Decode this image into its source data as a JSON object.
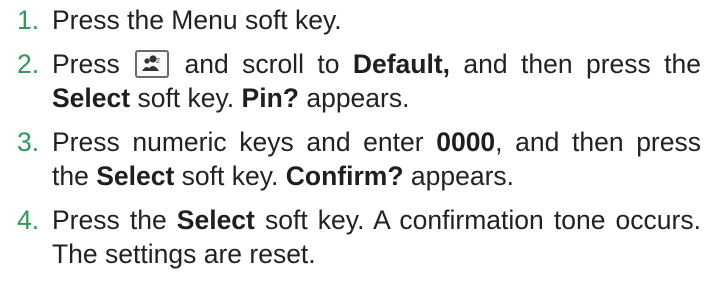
{
  "steps": [
    {
      "number": "1.",
      "parts": [
        "Press the Menu soft key."
      ]
    },
    {
      "number": "2.",
      "parts": [
        "Press",
        "and scroll to",
        "Default,",
        "and then press the",
        "Select",
        "soft key.",
        "Pin?",
        "appears."
      ],
      "icon": "contacts-key-icon"
    },
    {
      "number": "3.",
      "parts": [
        "Press numeric keys and enter",
        "0000",
        ", and then press the",
        "Select",
        "soft key.",
        "Confirm?",
        "appears."
      ]
    },
    {
      "number": "4.",
      "parts": [
        "Press the",
        "Select",
        "soft key. A confirmation tone occurs. The settings are reset."
      ]
    }
  ],
  "colors": {
    "number": "#2f9a57",
    "text": "#222222",
    "icon_border": "#6a6a6a"
  }
}
